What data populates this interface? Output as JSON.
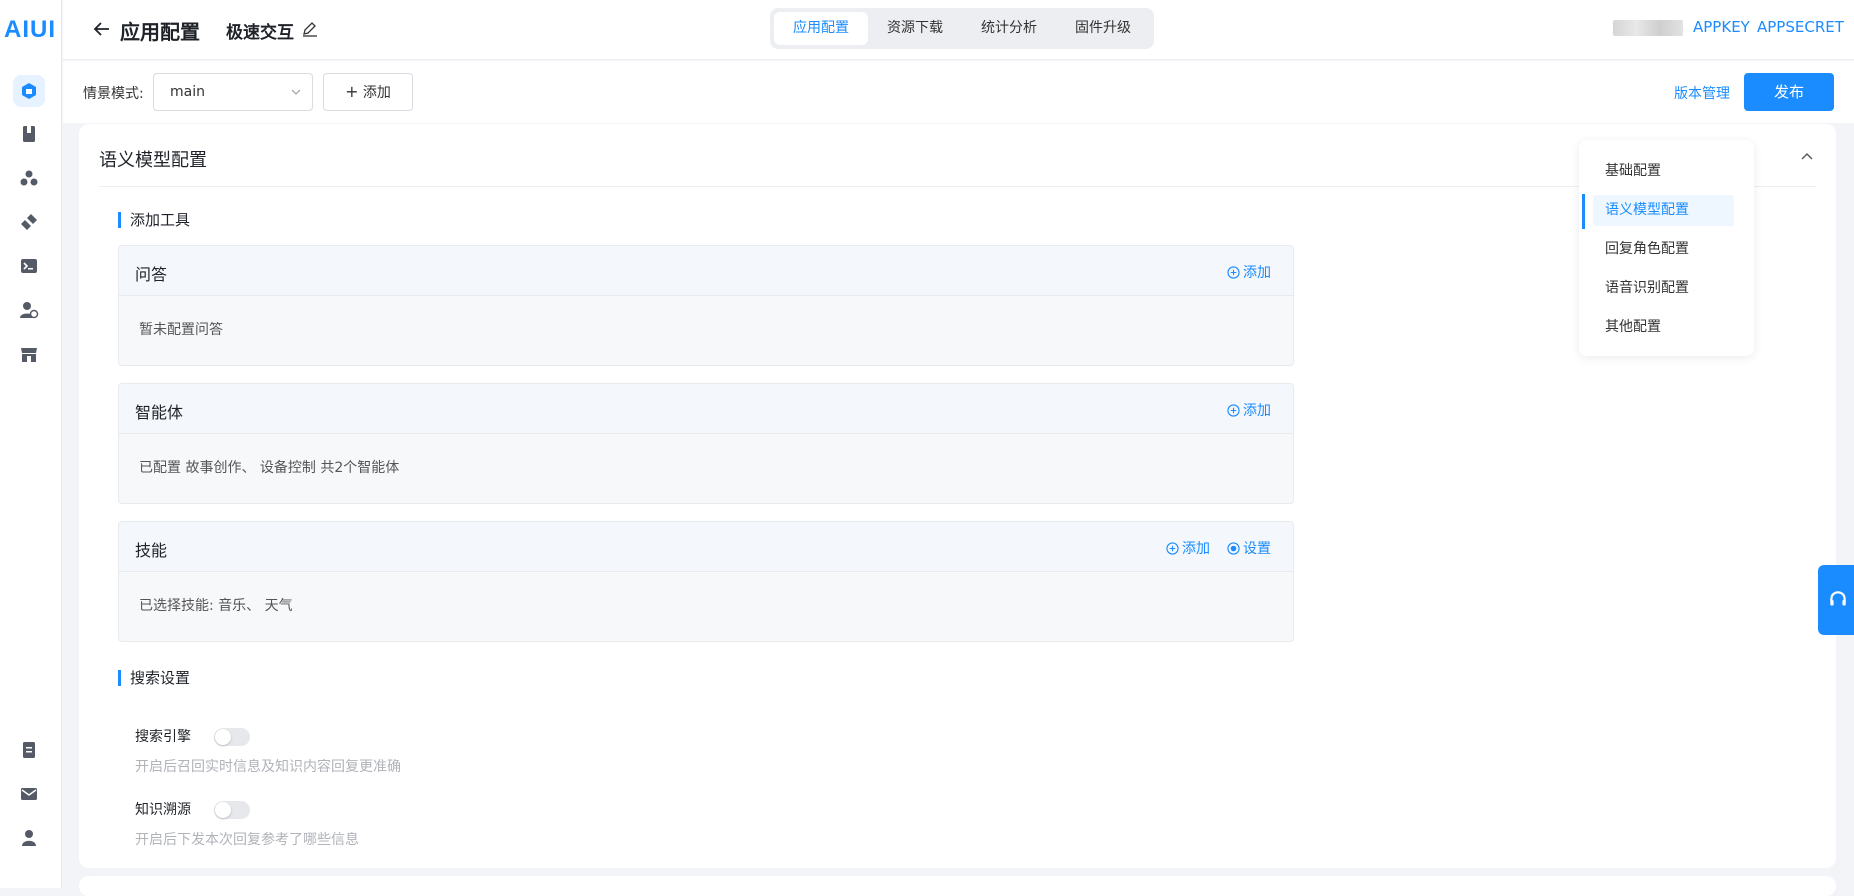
{
  "brand": {
    "logo_text": "AIUI"
  },
  "header": {
    "title": "应用配置",
    "app_name": "极速交互",
    "tabs": [
      "应用配置",
      "资源下载",
      "统计分析",
      "固件升级"
    ],
    "appkey_label": "APPKEY",
    "appsecret_label": "APPSECRET"
  },
  "toolbar": {
    "scene_label": "情景模式:",
    "scene_value": "main",
    "add_label": "添加",
    "version_label": "版本管理",
    "publish_label": "发布"
  },
  "section": {
    "title": "语义模型配置",
    "tools_title": "添加工具",
    "tools": [
      {
        "name": "问答",
        "add": "添加",
        "body": "暂未配置问答"
      },
      {
        "name": "智能体",
        "add": "添加",
        "body": "已配置 故事创作、 设备控制 共2个智能体"
      },
      {
        "name": "技能",
        "add": "添加",
        "settings": "设置",
        "body": "已选择技能:  音乐、 天气"
      }
    ],
    "search_title": "搜索设置",
    "search_engine_label": "搜索引擎",
    "search_engine_desc": "开启后召回实时信息及知识内容回复更准确",
    "knowledge_label": "知识溯源",
    "knowledge_desc": "开启后下发本次回复参考了哪些信息"
  },
  "anchors": [
    "基础配置",
    "语义模型配置",
    "回复角色配置",
    "语音识别配置",
    "其他配置"
  ],
  "colors": {
    "accent": "#1a8cff"
  }
}
